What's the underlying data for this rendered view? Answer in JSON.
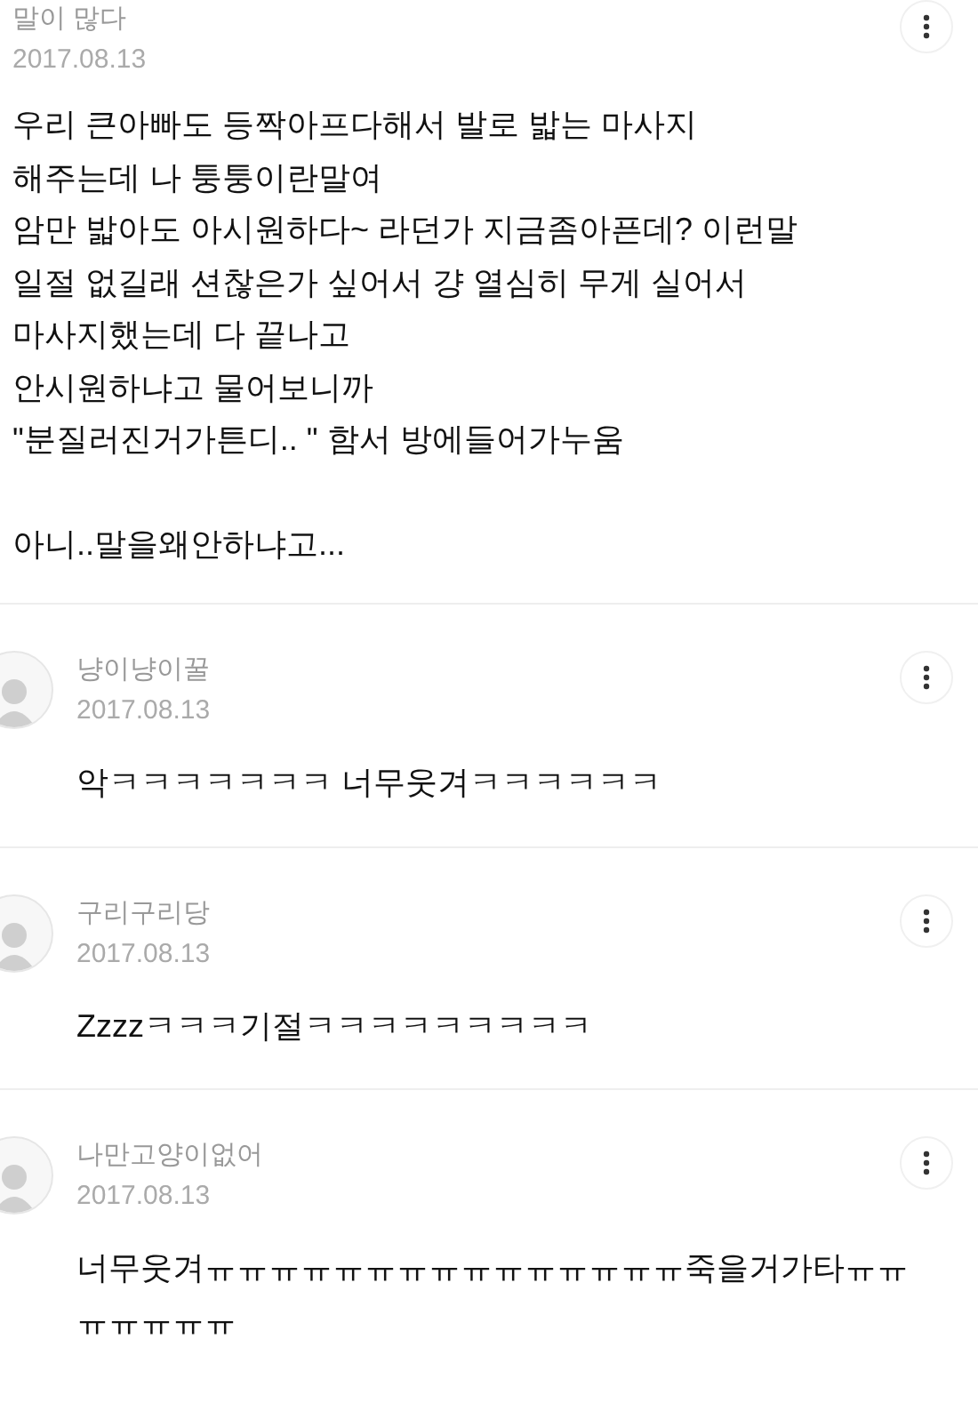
{
  "post": {
    "author": "말이 많다",
    "date": "2017.08.13",
    "paragraphs": [
      [
        "우리 큰아빠도 등짝아프다해서 발로 밟는 마사지",
        "해주는데 나 퉁퉁이란말여",
        "암만 밟아도 아시원하다~ 라던가 지금좀아픈데? 이런말",
        "일절 없길래 션찮은가 싶어서 걍 열심히 무게 실어서",
        "마사지했는데 다 끝나고",
        "안시원하냐고 물어보니까",
        "\"분질러진거가튼디.. \" 함서 방에들어가누움"
      ],
      [
        "아니..말을왜안하냐고..."
      ]
    ]
  },
  "comments": [
    {
      "author": "냥이냥이꿀",
      "date": "2017.08.13",
      "lines": [
        "악ㅋㅋㅋㅋㅋㅋㅋ 너무웃겨ㅋㅋㅋㅋㅋㅋ"
      ]
    },
    {
      "author": "구리구리당",
      "date": "2017.08.13",
      "lines": [
        "Zzzzㅋㅋㅋ기절ㅋㅋㅋㅋㅋㅋㅋㅋㅋ"
      ]
    },
    {
      "author": "나만고양이없어",
      "date": "2017.08.13",
      "lines": [
        "너무웃겨ㅠㅠㅠㅠㅠㅠㅠㅠㅠㅠㅠㅠㅠㅠㅠ죽을거가타ㅠㅠ",
        "ㅠㅠㅠㅠㅠ"
      ]
    }
  ]
}
